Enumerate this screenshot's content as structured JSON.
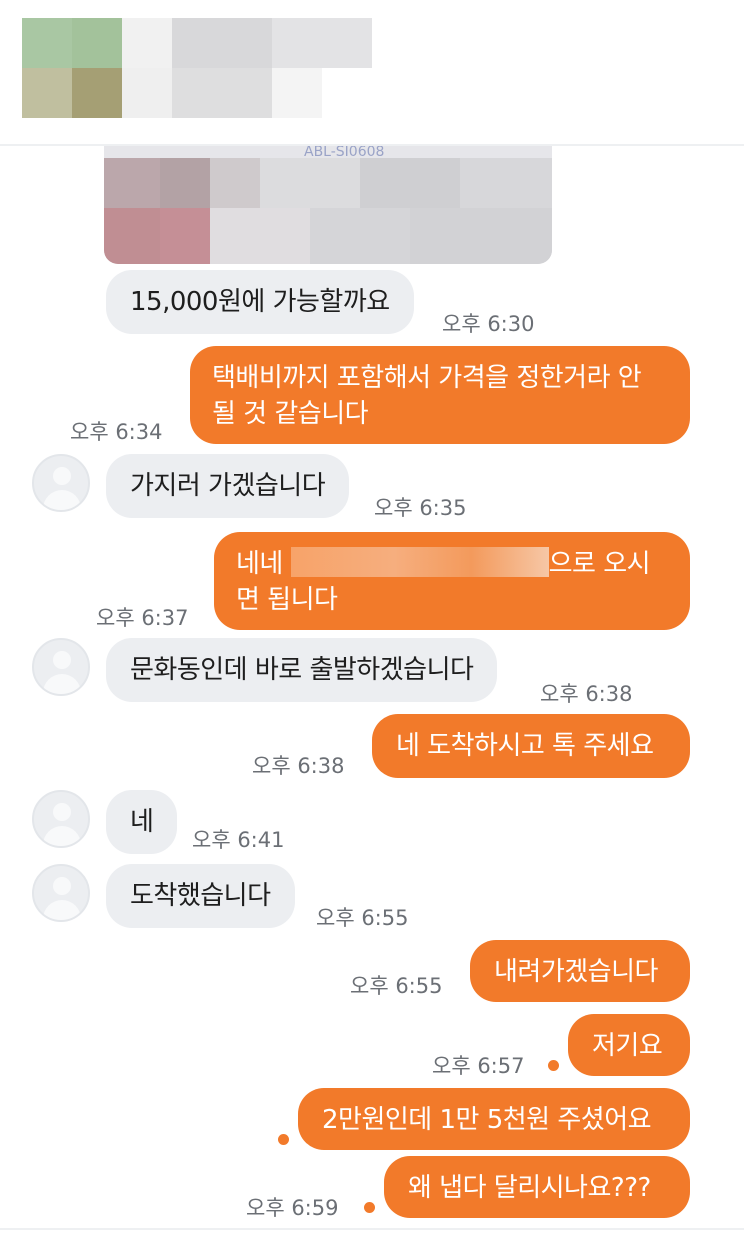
{
  "colors": {
    "outgoing_bubble": "#f27a2a",
    "incoming_bubble": "#eceef1",
    "timestamp": "#6b6f75",
    "unread_dot": "#f27a2a"
  },
  "header": {
    "redacted": true,
    "avatar_icon": "blurred-profile-icon"
  },
  "photo_message": {
    "visible_text": "ABL-SI0608",
    "redacted": true
  },
  "messages": [
    {
      "id": "m1",
      "direction": "incoming",
      "text": "15,000원에 가능할까요",
      "time": "오후 6:30",
      "avatar": false
    },
    {
      "id": "m2",
      "direction": "outgoing",
      "lines": [
        "택배비까지 포함해서 가격을 정한거라 안",
        "될 것 같습니다"
      ],
      "time": "오후 6:34"
    },
    {
      "id": "m3",
      "direction": "incoming",
      "text": "가지러 가겠습니다",
      "time": "오후 6:35",
      "avatar": true
    },
    {
      "id": "m4",
      "direction": "outgoing",
      "line1_start": "네네",
      "line1_end": "으로 오시",
      "line2": "면 됩니다",
      "address_redacted": true,
      "time": "오후 6:37"
    },
    {
      "id": "m5",
      "direction": "incoming",
      "text": "문화동인데 바로 출발하겠습니다",
      "time": "오후 6:38",
      "avatar": true
    },
    {
      "id": "m6",
      "direction": "outgoing",
      "text": "네 도착하시고 톡 주세요",
      "time": "오후 6:38"
    },
    {
      "id": "m7",
      "direction": "incoming",
      "text": "네",
      "time": "오후 6:41",
      "avatar": true
    },
    {
      "id": "m8",
      "direction": "incoming",
      "text": "도착했습니다",
      "time": "오후 6:55",
      "avatar": true
    },
    {
      "id": "m9",
      "direction": "outgoing",
      "text": "내려가겠습니다",
      "time": "오후 6:55"
    },
    {
      "id": "m10",
      "direction": "outgoing",
      "text": "저기요",
      "time": "오후 6:57",
      "unread": true
    },
    {
      "id": "m11",
      "direction": "outgoing",
      "text": "2만원인데 1만 5천원 주셨어요",
      "time": "",
      "unread": true
    },
    {
      "id": "m12",
      "direction": "outgoing",
      "text": "왜 냅다 달리시나요???",
      "time": "오후 6:59",
      "unread": true
    }
  ]
}
